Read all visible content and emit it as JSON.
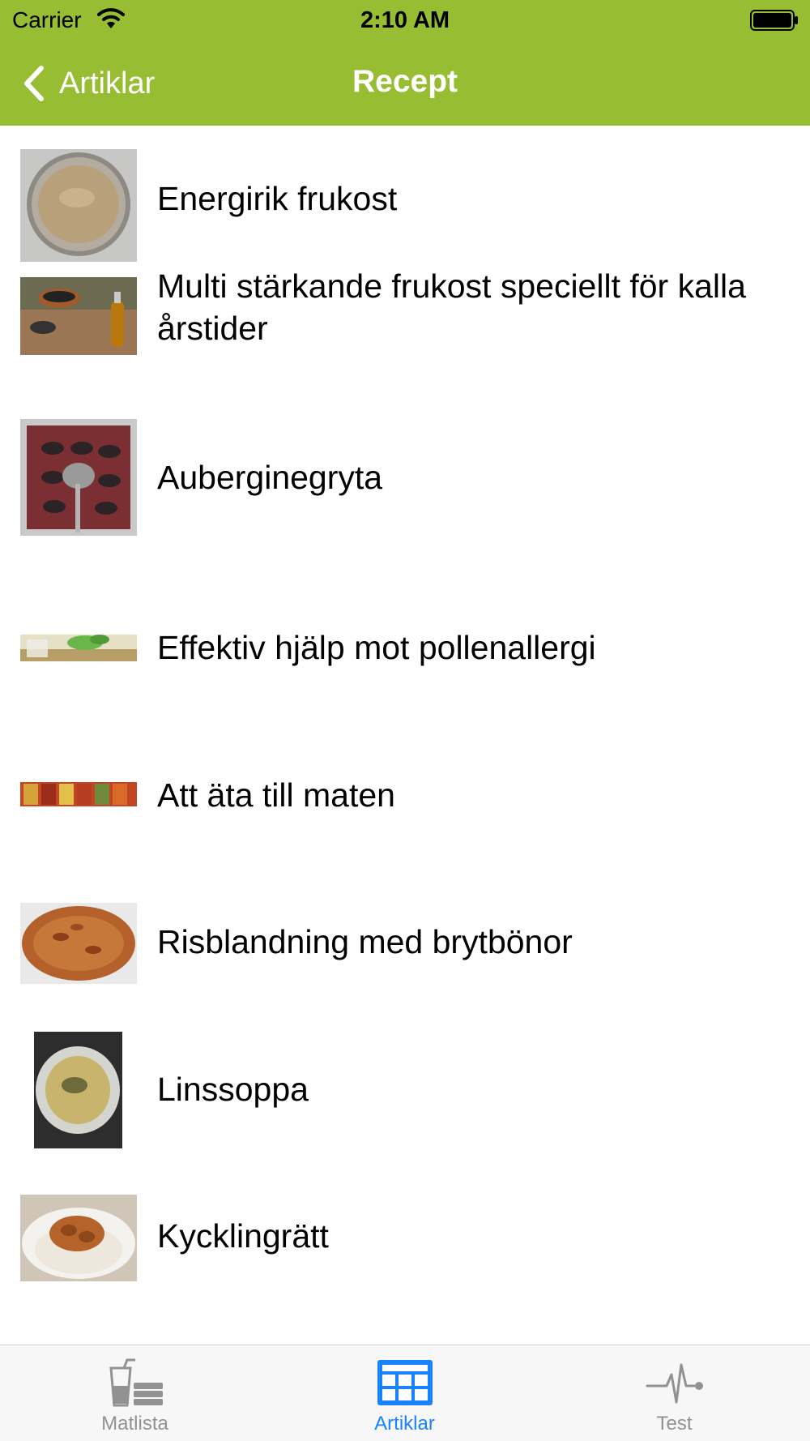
{
  "status_bar": {
    "carrier": "Carrier",
    "time": "2:10 AM",
    "wifi_icon": "wifi-icon",
    "battery_icon": "battery-icon"
  },
  "nav_bar": {
    "back_label": "Artiklar",
    "title": "Recept",
    "background_color": "#97bd32"
  },
  "recipes": [
    {
      "title": "Energirik frukost",
      "thumbnail": "bowl-of-porridge"
    },
    {
      "title": "Multi stärkande frukost speciellt för kalla årstider",
      "thumbnail": "seeds-and-oil-bottle"
    },
    {
      "title": "Auberginegryta",
      "thumbnail": "eggplant-casserole"
    },
    {
      "title": "Effektiv hjälp mot pollenallergi",
      "thumbnail": "mint-tea"
    },
    {
      "title": "Att äta till maten",
      "thumbnail": "pickled-jars"
    },
    {
      "title": "Risblandning med brytbönor",
      "thumbnail": "rice-platter"
    },
    {
      "title": "Linssoppa",
      "thumbnail": "lentil-soup"
    },
    {
      "title": "Kycklingrätt",
      "thumbnail": "chicken-with-rice"
    }
  ],
  "tab_bar": {
    "tabs": [
      {
        "label": "Matlista",
        "icon": "drink-and-food-icon",
        "active": false
      },
      {
        "label": "Artiklar",
        "icon": "newspaper-icon",
        "active": true
      },
      {
        "label": "Test",
        "icon": "heartbeat-icon",
        "active": false
      }
    ],
    "active_color": "#1a82fb",
    "inactive_color": "#929292"
  }
}
